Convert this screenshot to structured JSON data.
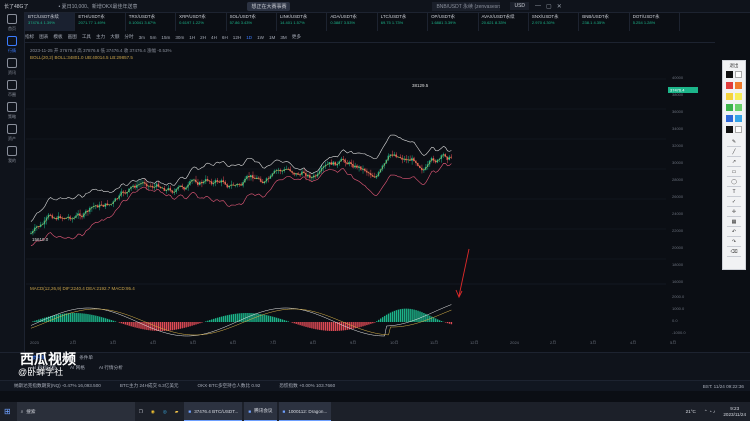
{
  "titlebar": {
    "app_title": "长了48G了",
    "notice": "• 夏日10,000、新增OKX最佳年送意",
    "banner": "想正在大赛事赛",
    "search_placeholder": "BNB/USDT 永续 (zenvasesrsesst...",
    "currency": "USD"
  },
  "leftnav": [
    {
      "label": "首页"
    },
    {
      "label": "行情",
      "active": true
    },
    {
      "label": "资讯"
    },
    {
      "label": "币圈"
    },
    {
      "label": "策略"
    },
    {
      "label": "资产"
    },
    {
      "label": "我的"
    }
  ],
  "tickers": [
    {
      "name": "BTC/USDT永续",
      "value": "37476.4",
      "change": "1.39%",
      "dir": "up",
      "active": true
    },
    {
      "name": "ETH/USDT永",
      "value": "2071.77",
      "change": "1.49%",
      "dir": "up"
    },
    {
      "name": "TRX/USDT永",
      "value": "0.10041",
      "change": "3.67%",
      "dir": "up"
    },
    {
      "name": "XRP/USDT永",
      "value": "0.6197",
      "change": "1.22%",
      "dir": "up"
    },
    {
      "name": "SOL/USDT永",
      "value": "57.86",
      "change": "3.43%",
      "dir": "up"
    },
    {
      "name": "LINK/USDT永",
      "value": "14.401",
      "change": "1.57%",
      "dir": "up"
    },
    {
      "name": "ADA/USDT永",
      "value": "0.3887",
      "change": "3.53%",
      "dir": "up"
    },
    {
      "name": "LTC/USDT永",
      "value": "69.75",
      "change": "1.73%",
      "dir": "up"
    },
    {
      "name": "OP/USDT永",
      "value": "1.6881",
      "change": "3.39%",
      "dir": "up"
    },
    {
      "name": "AVAX/USDT永续",
      "value": "20.621",
      "change": "8.33%",
      "dir": "up"
    },
    {
      "name": "SNX/USDT永",
      "value": "2.970",
      "change": "4.30%",
      "dir": "up"
    },
    {
      "name": "BNB/USDT永",
      "value": "238.1",
      "change": "4.35%",
      "dir": "up"
    },
    {
      "name": "DOT/USDT永",
      "value": "5.254",
      "change": "1.28%",
      "dir": "up"
    }
  ],
  "toolbar": {
    "items": [
      "指标",
      "图表",
      "模板",
      "画图",
      "工具",
      "主力",
      "大额",
      "分时",
      "3m",
      "5m",
      "15m",
      "30m",
      "1H",
      "2H",
      "4H",
      "6H",
      "12H",
      "1D",
      "1W",
      "1M",
      "3M",
      "更多"
    ],
    "selected": "1D"
  },
  "chart": {
    "info_line1": "2023-11-25 开 37679.4 高 37876.6 低 37476.4 收 37476.4 涨幅 -0.53%",
    "info_line2": "BOLL(20,2)  BOLL:34801.0  UB:40014.5  LB:29857.5",
    "high_label": "38129.5",
    "low_label": "15610.0",
    "macd_label": "MACD(12,26,9)  DIF:2240.4  DEA:2192.7  MACD:95.4",
    "price_axis": [
      "40000",
      "38000",
      "36000",
      "34000",
      "32000",
      "30000",
      "28000",
      "26000",
      "24000",
      "22000",
      "20000",
      "18000",
      "16000"
    ],
    "macd_axis": [
      "2000.0",
      "1000.0",
      "0.0",
      "-1000.0"
    ],
    "x_labels": [
      "2023",
      "2月",
      "3月",
      "4月",
      "5月",
      "6月",
      "7月",
      "8月",
      "9月",
      "10月",
      "11月",
      "12月",
      "2024",
      "2月",
      "3月",
      "4月",
      "5月"
    ],
    "current_price": "37476.4",
    "sub_tabs": [
      "VOL",
      "MA",
      "BOLL",
      "MA",
      "EMA",
      "BOLL",
      "SAR",
      "MACD",
      "RSI",
      "Volume"
    ]
  },
  "bottom": {
    "tabs": [
      "委托单",
      "持仓",
      "盈亏",
      "条件单"
    ],
    "links": [
      "AI 指标分析",
      "AI 网格",
      "AI 行情分析"
    ],
    "watermark": "西瓜视频",
    "watermark_sub": "@卧蝉学社"
  },
  "tickerstrip": {
    "items": [
      "纳斯达克指数期货(NQ) -0.47% 16,093.500",
      "BTC主力 24H成交 6.3亿美元",
      "OKX·BTC多空持仓人数比 0.92",
      "恐慌指数 +0.00% 103.7660"
    ],
    "clock": "BST: 11/24 09:22:36",
    "date": "2023/11/24 09:22:58"
  },
  "taskbar": {
    "search": "搜索",
    "apps": [
      {
        "label": "37476.4 BTC/USDT..."
      },
      {
        "label": "腾讯会议"
      },
      {
        "label": "1000112: Dragon..."
      }
    ],
    "weather": "21°C",
    "time": "9:23",
    "date": "2023/11/24"
  },
  "colors": {
    "up": "#1cb58a",
    "down": "#e04a55",
    "accent": "#3b7cff",
    "arrow": "#e02a2a"
  }
}
